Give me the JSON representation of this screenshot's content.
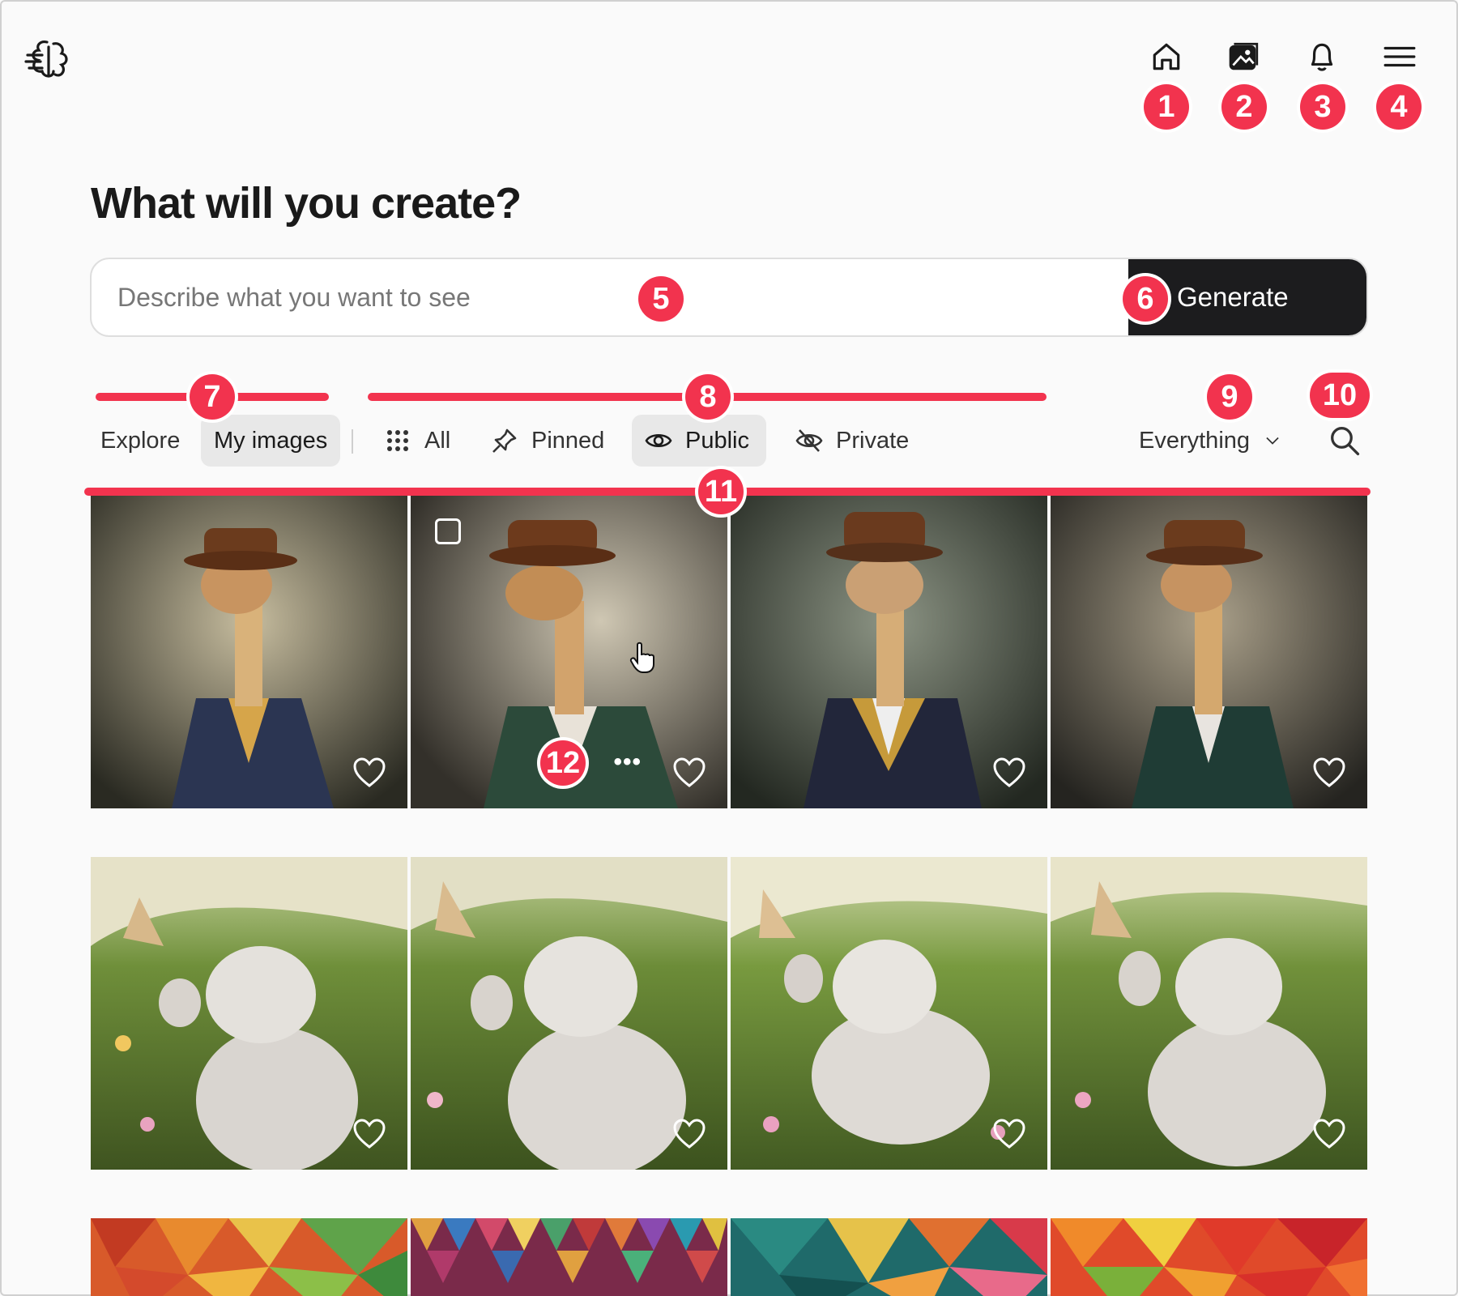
{
  "header": {
    "nav": [
      {
        "name": "home-icon",
        "badge": "1"
      },
      {
        "name": "images-icon",
        "badge": "2"
      },
      {
        "name": "bell-icon",
        "badge": "3"
      },
      {
        "name": "menu-icon",
        "badge": "4"
      }
    ]
  },
  "main": {
    "title": "What will you create?",
    "prompt": {
      "placeholder": "Describe what you want to see",
      "value": "",
      "badge": "5"
    },
    "generate": {
      "label": "Generate",
      "badge": "6"
    }
  },
  "filters": {
    "scope_tabs": [
      {
        "label": "Explore",
        "active": false
      },
      {
        "label": "My images",
        "active": true
      }
    ],
    "scope_badge": "7",
    "visibility_tabs": [
      {
        "label": "All",
        "icon": "grid-dots-icon",
        "active": false
      },
      {
        "label": "Pinned",
        "icon": "pin-icon",
        "active": false
      },
      {
        "label": "Public",
        "icon": "eye-icon",
        "active": true
      },
      {
        "label": "Private",
        "icon": "eye-off-icon",
        "active": false
      }
    ],
    "visibility_badge": "8",
    "type_select": {
      "value": "Everything",
      "badge": "9"
    },
    "search_badge": "10",
    "grid_badge": "11"
  },
  "gallery": {
    "rows": [
      {
        "subject": "giraffe-portrait",
        "count": 4
      },
      {
        "subject": "kitten-butterfly",
        "count": 4
      },
      {
        "subject": "low-poly-abstract",
        "count": 4
      }
    ],
    "hovered_tile_badge": "12"
  },
  "colors": {
    "accent": "#f2334e",
    "button_dark": "#1c1c1e",
    "active_tab_bg": "#e8e8e8"
  }
}
